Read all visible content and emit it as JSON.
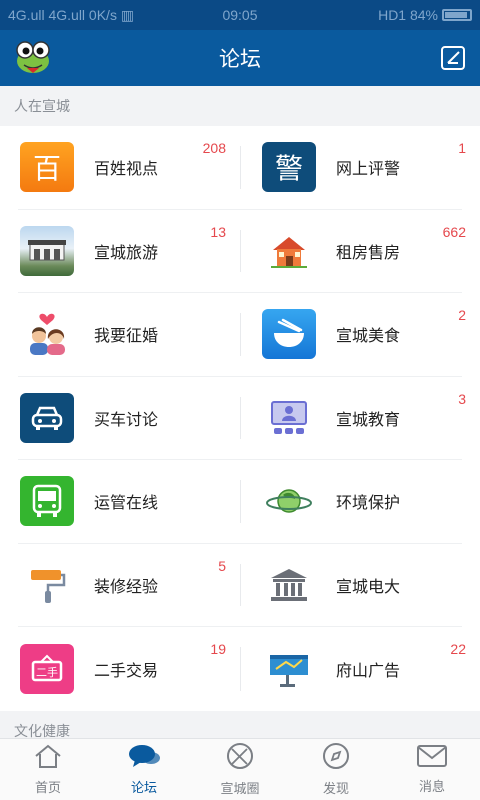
{
  "status": {
    "left": "4G.ull 4G.ull 0K/s ▥",
    "time": "09:05",
    "right": "HD1 84%"
  },
  "header": {
    "title": "论坛"
  },
  "sections": [
    {
      "title": "人在宣城"
    },
    {
      "title": "文化健康"
    }
  ],
  "rows": [
    [
      {
        "label": "百姓视点",
        "count": "208",
        "icon": "bai-char-icon"
      },
      {
        "label": "网上评警",
        "count": "1",
        "icon": "police-char-icon"
      }
    ],
    [
      {
        "label": "宣城旅游",
        "count": "13",
        "icon": "travel-photo-icon"
      },
      {
        "label": "租房售房",
        "count": "662",
        "icon": "house-icon"
      }
    ],
    [
      {
        "label": "我要征婚",
        "count": "",
        "icon": "couple-icon"
      },
      {
        "label": "宣城美食",
        "count": "2",
        "icon": "bowl-icon"
      }
    ],
    [
      {
        "label": "买车讨论",
        "count": "",
        "icon": "car-icon"
      },
      {
        "label": "宣城教育",
        "count": "3",
        "icon": "classroom-icon"
      }
    ],
    [
      {
        "label": "运管在线",
        "count": "",
        "icon": "bus-icon"
      },
      {
        "label": "环境保护",
        "count": "",
        "icon": "planet-icon"
      }
    ],
    [
      {
        "label": "装修经验",
        "count": "5",
        "icon": "paint-roller-icon"
      },
      {
        "label": "宣城电大",
        "count": "",
        "icon": "building-icon"
      }
    ],
    [
      {
        "label": "二手交易",
        "count": "19",
        "icon": "secondhand-sign-icon"
      },
      {
        "label": "府山广告",
        "count": "22",
        "icon": "billboard-icon"
      }
    ]
  ],
  "tabs": [
    {
      "label": "首页",
      "icon": "home-icon",
      "active": false
    },
    {
      "label": "论坛",
      "icon": "chat-bubbles-icon",
      "active": true
    },
    {
      "label": "宣城圈",
      "icon": "circle-icon",
      "active": false
    },
    {
      "label": "发现",
      "icon": "compass-icon",
      "active": false
    },
    {
      "label": "消息",
      "icon": "mail-icon",
      "active": false
    }
  ],
  "colors": {
    "header": "#0a5a9e",
    "accent": "#0a5a9e",
    "count": "#e5484d"
  }
}
